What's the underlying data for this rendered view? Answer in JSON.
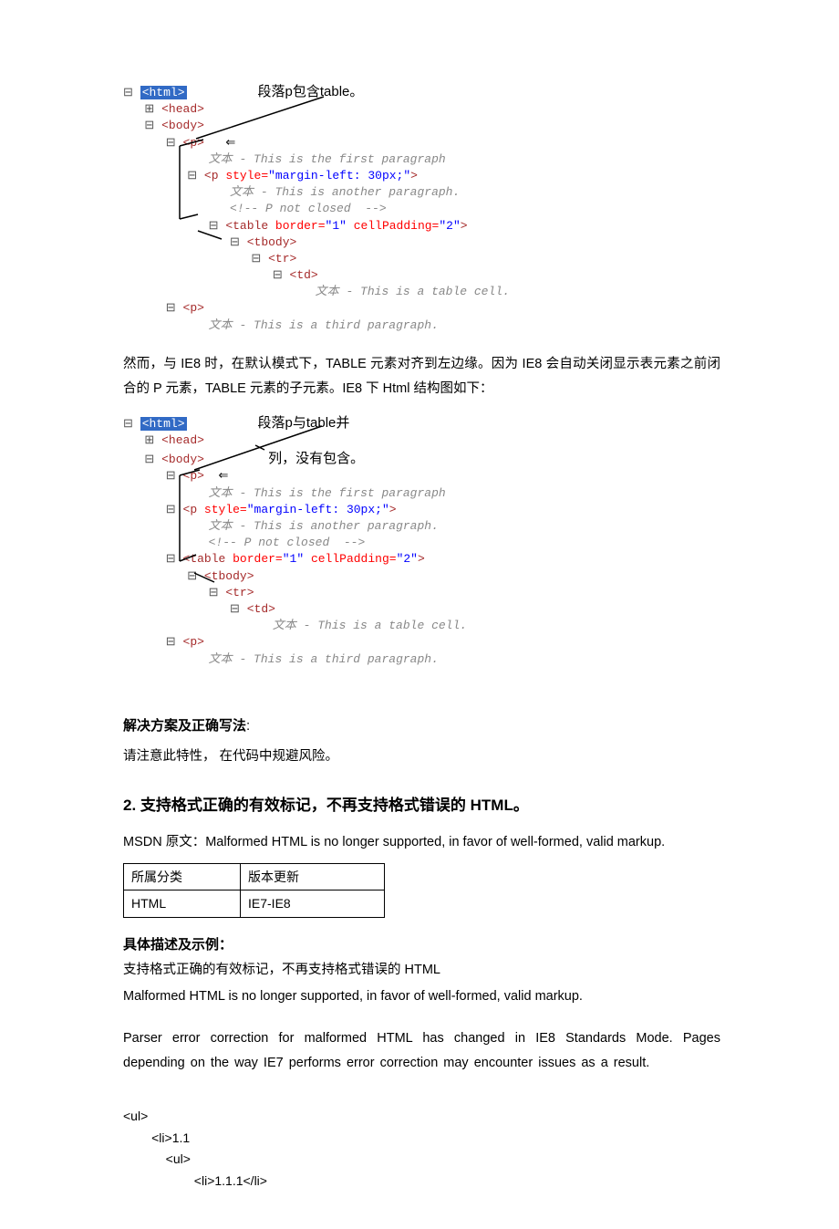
{
  "tree1": {
    "annotation": "段落p包含table。",
    "html": "<html>",
    "head": "<head>",
    "body": "<body>",
    "p1": "<p>",
    "text1a": "文本",
    "text1b": " - This is the first paragraph",
    "p2a": "<p ",
    "p2b": "style=",
    "p2c": "\"margin-left: 30px;\"",
    "p2d": ">",
    "text2a": "文本",
    "text2b": " - This is another paragraph.",
    "comment": "<!-- P not closed  -->",
    "table_a": "<table ",
    "table_b": "border=",
    "table_c": "\"1\"",
    "table_d": " cellPadding=",
    "table_e": "\"2\"",
    "table_f": ">",
    "tbody": "<tbody>",
    "tr": "<tr>",
    "td": "<td>",
    "cell_a": "文本",
    "cell_b": " - This is a table cell.",
    "p3": "<p>",
    "text3a": "文本",
    "text3b": " - This is a third paragraph."
  },
  "para1": "然而，与 IE8 时，在默认模式下，TABLE 元素对齐到左边缘。因为 IE8 会自动关闭显示表元素之前闭合的 P 元素，TABLE 元素的子元素。IE8 下 Html 结构图如下：",
  "tree2": {
    "annotation1": "段落p与table并",
    "annotation2": "列，没有包含。"
  },
  "solution": {
    "title": "解决方案及正确写法",
    "colon": ":",
    "note": "请注意此特性，  在代码中规避风险。"
  },
  "section2": {
    "num": "2. ",
    "title": "支持格式正确的有效标记，不再支持格式错误的  HTML。"
  },
  "msdn": "MSDN 原文：Malformed HTML is no longer supported, in favor of well-formed, valid markup.",
  "table": {
    "h1": "所属分类",
    "h2": "版本更新",
    "r1": "HTML",
    "r2": "IE7-IE8"
  },
  "detail": {
    "title": "具体描述及示例：",
    "line1": "支持格式正确的有效标记，不再支持格式错误的  HTML",
    "line2": "Malformed HTML is no longer supported, in favor of well-formed, valid markup.",
    "line3": "Parser  error  correction  for  malformed  HTML  has  changed  in  IE8  Standards  Mode.  Pages depending on the way IE7 performs error correction may encounter issues as a result."
  },
  "code": {
    "l1": "<ul>",
    "l2": "        <li>1.1",
    "l3": "            <ul>",
    "l4": "                    <li>1.1.1</li>"
  }
}
